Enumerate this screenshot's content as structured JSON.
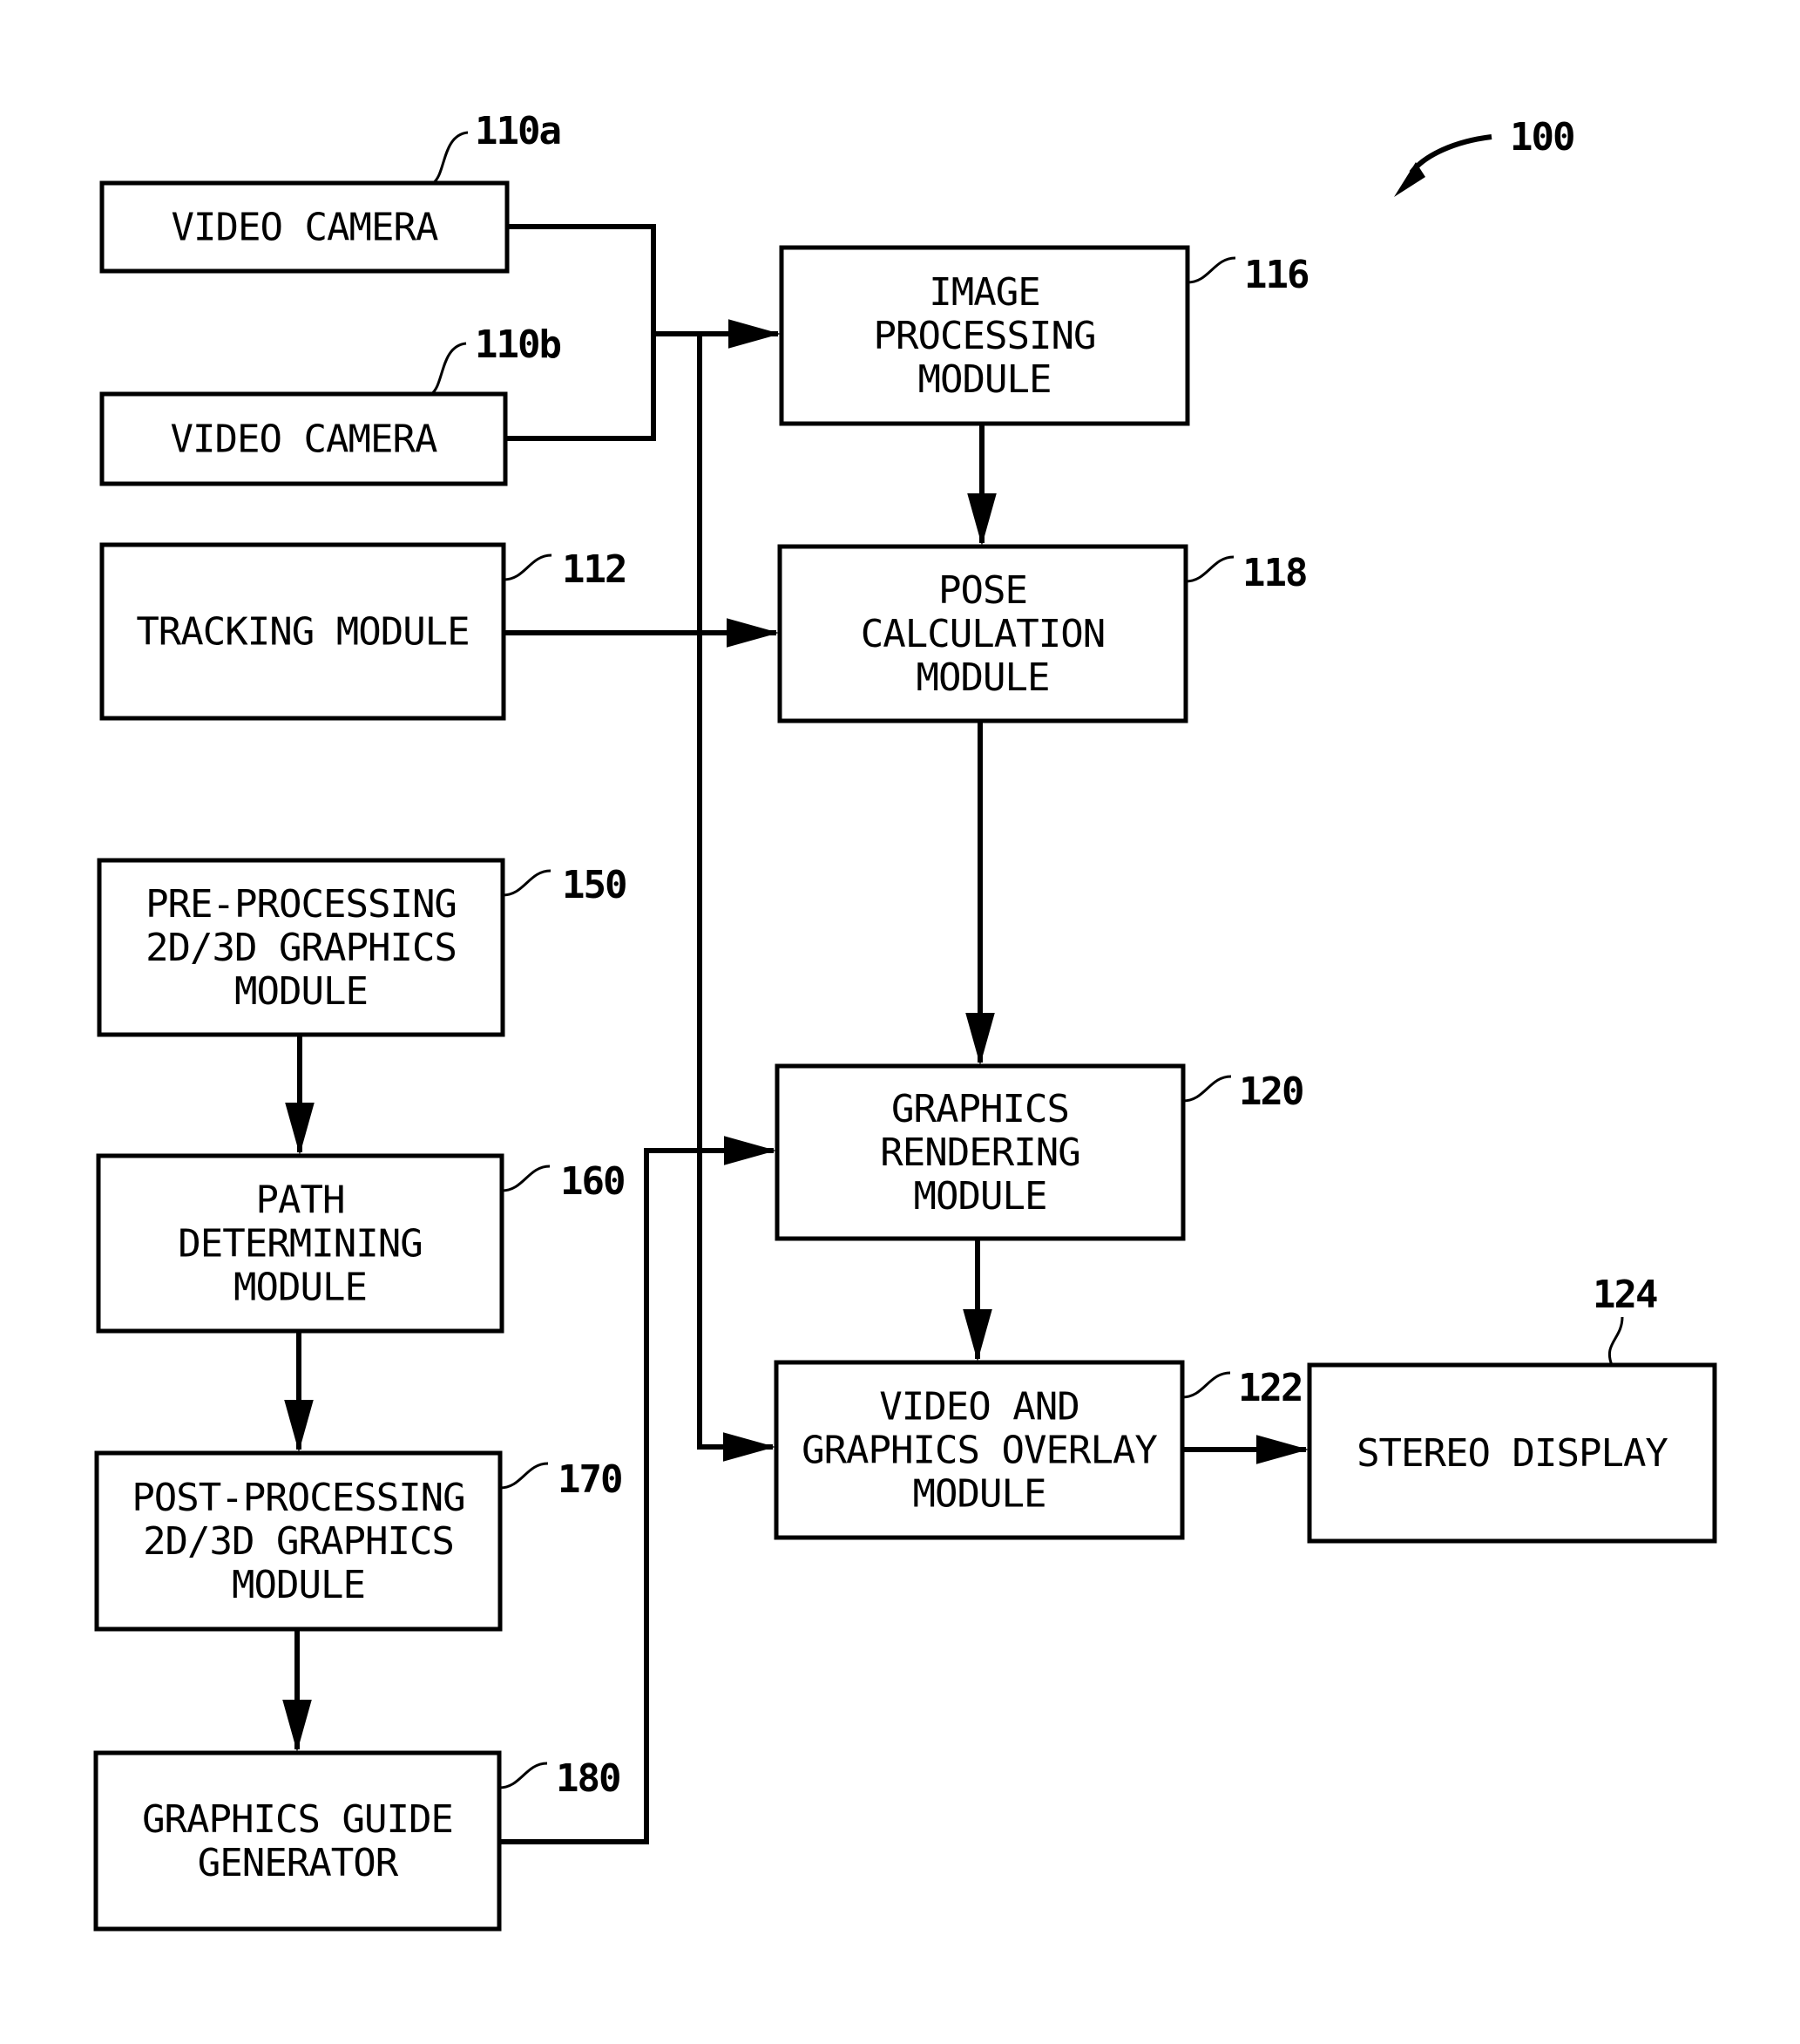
{
  "figure": {
    "ref": "100",
    "blocks": [
      {
        "id": "110a",
        "ref": "110a",
        "lines": [
          "VIDEO CAMERA"
        ]
      },
      {
        "id": "110b",
        "ref": "110b",
        "lines": [
          "VIDEO CAMERA"
        ]
      },
      {
        "id": "112",
        "ref": "112",
        "lines": [
          "TRACKING MODULE"
        ]
      },
      {
        "id": "116",
        "ref": "116",
        "lines": [
          "IMAGE",
          "PROCESSING",
          "MODULE"
        ]
      },
      {
        "id": "118",
        "ref": "118",
        "lines": [
          "POSE",
          "CALCULATION",
          "MODULE"
        ]
      },
      {
        "id": "120",
        "ref": "120",
        "lines": [
          "GRAPHICS",
          "RENDERING",
          "MODULE"
        ]
      },
      {
        "id": "122",
        "ref": "122",
        "lines": [
          "VIDEO AND",
          "GRAPHICS OVERLAY",
          "MODULE"
        ]
      },
      {
        "id": "124",
        "ref": "124",
        "lines": [
          "STEREO DISPLAY"
        ]
      },
      {
        "id": "150",
        "ref": "150",
        "lines": [
          "PRE-PROCESSING",
          "2D/3D GRAPHICS",
          "MODULE"
        ]
      },
      {
        "id": "160",
        "ref": "160",
        "lines": [
          "PATH",
          "DETERMINING",
          "MODULE"
        ]
      },
      {
        "id": "170",
        "ref": "170",
        "lines": [
          "POST-PROCESSING",
          "2D/3D GRAPHICS",
          "MODULE"
        ]
      },
      {
        "id": "180",
        "ref": "180",
        "lines": [
          "GRAPHICS GUIDE",
          "GENERATOR"
        ]
      }
    ],
    "connections": [
      {
        "from": "110a",
        "to": "116"
      },
      {
        "from": "110b",
        "to": "116"
      },
      {
        "from": "110a",
        "to": "122"
      },
      {
        "from": "110b",
        "to": "122"
      },
      {
        "from": "112",
        "to": "118"
      },
      {
        "from": "116",
        "to": "118"
      },
      {
        "from": "118",
        "to": "120"
      },
      {
        "from": "120",
        "to": "122"
      },
      {
        "from": "122",
        "to": "124"
      },
      {
        "from": "150",
        "to": "160"
      },
      {
        "from": "160",
        "to": "170"
      },
      {
        "from": "170",
        "to": "180"
      },
      {
        "from": "180",
        "to": "120"
      }
    ]
  }
}
